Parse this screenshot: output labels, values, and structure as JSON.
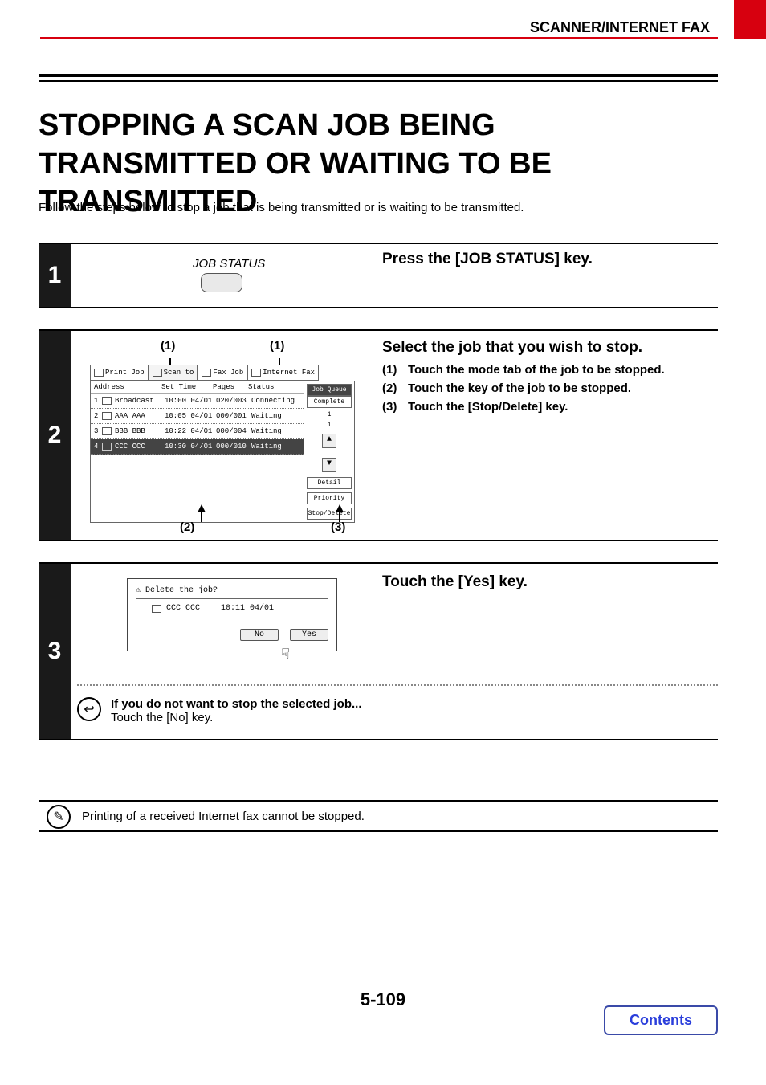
{
  "header": {
    "section": "SCANNER/INTERNET FAX"
  },
  "title": "STOPPING A SCAN JOB BEING TRANSMITTED OR WAITING TO BE TRANSMITTED",
  "intro": "Follow the steps below to stop a job that is being transmitted or is waiting to be transmitted.",
  "step1": {
    "num": "1",
    "key_label": "JOB STATUS",
    "instruction": "Press the [JOB STATUS] key."
  },
  "step2": {
    "num": "2",
    "callouts": {
      "c1a": "(1)",
      "c1b": "(1)",
      "c2": "(2)",
      "c3": "(3)"
    },
    "tabs": [
      "Print Job",
      "Scan to",
      "Fax Job",
      "Internet Fax"
    ],
    "col_headers": {
      "addr": "Address",
      "time": "Set Time",
      "pages": "Pages",
      "status": "Status"
    },
    "rows": [
      {
        "n": "1",
        "addr": "Broadcast",
        "time": "10:00 04/01",
        "pages": "020/003",
        "status": "Connecting"
      },
      {
        "n": "2",
        "addr": "AAA AAA",
        "time": "10:05 04/01",
        "pages": "000/001",
        "status": "Waiting"
      },
      {
        "n": "3",
        "addr": "BBB BBB",
        "time": "10:22 04/01",
        "pages": "000/004",
        "status": "Waiting"
      },
      {
        "n": "4",
        "addr": "CCC CCC",
        "time": "10:30 04/01",
        "pages": "000/010",
        "status": "Waiting"
      }
    ],
    "side": {
      "job_queue": "Job Queue",
      "complete": "Complete",
      "count1": "1",
      "count2": "1",
      "detail": "Detail",
      "priority": "Priority",
      "stop": "Stop/Delete"
    },
    "instruction": "Select the job that you wish to stop.",
    "subs": [
      {
        "lbl": "(1)",
        "txt": "Touch the mode tab of the job to be stopped."
      },
      {
        "lbl": "(2)",
        "txt": "Touch the key of the job to be stopped."
      },
      {
        "lbl": "(3)",
        "txt": "Touch the [Stop/Delete] key."
      }
    ]
  },
  "step3": {
    "num": "3",
    "instruction": "Touch the [Yes] key.",
    "dialog": {
      "question": "Delete the job?",
      "job": "CCC CCC",
      "time": "10:11 04/01",
      "no": "No",
      "yes": "Yes"
    },
    "note_title": "If you do not want to stop the selected job...",
    "note_body": "Touch the [No] key."
  },
  "footnote": "Printing of a received Internet fax cannot be stopped.",
  "page_number": "5-109",
  "contents": "Contents"
}
